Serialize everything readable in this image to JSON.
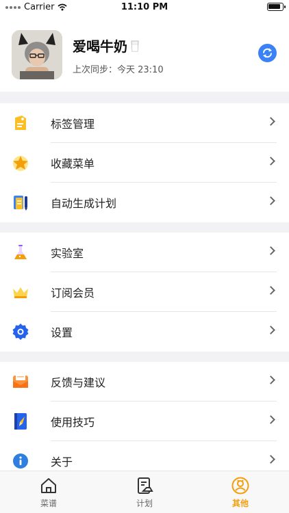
{
  "status_bar": {
    "carrier": "Carrier",
    "time": "11:10 PM"
  },
  "profile": {
    "name": "爱喝牛奶",
    "sync_text": "上次同步：今天 23:10"
  },
  "menu_groups": [
    [
      {
        "label": "标签管理",
        "icon": "tag-icon"
      },
      {
        "label": "收藏菜单",
        "icon": "star-icon"
      },
      {
        "label": "自动生成计划",
        "icon": "plan-generate-icon"
      }
    ],
    [
      {
        "label": "实验室",
        "icon": "flask-icon"
      },
      {
        "label": "订阅会员",
        "icon": "crown-icon"
      },
      {
        "label": "设置",
        "icon": "gear-icon"
      }
    ],
    [
      {
        "label": "反馈与建议",
        "icon": "mailbox-icon"
      },
      {
        "label": "使用技巧",
        "icon": "guide-book-icon"
      },
      {
        "label": "关于",
        "icon": "info-icon"
      }
    ]
  ],
  "tabs": [
    {
      "label": "菜谱",
      "icon": "home-icon",
      "active": false
    },
    {
      "label": "计划",
      "icon": "plan-icon",
      "active": false
    },
    {
      "label": "其他",
      "icon": "other-icon",
      "active": true
    }
  ],
  "colors": {
    "accent": "#f59e0b",
    "sync_button": "#3b82f6",
    "info_blue": "#2f7fe0"
  }
}
